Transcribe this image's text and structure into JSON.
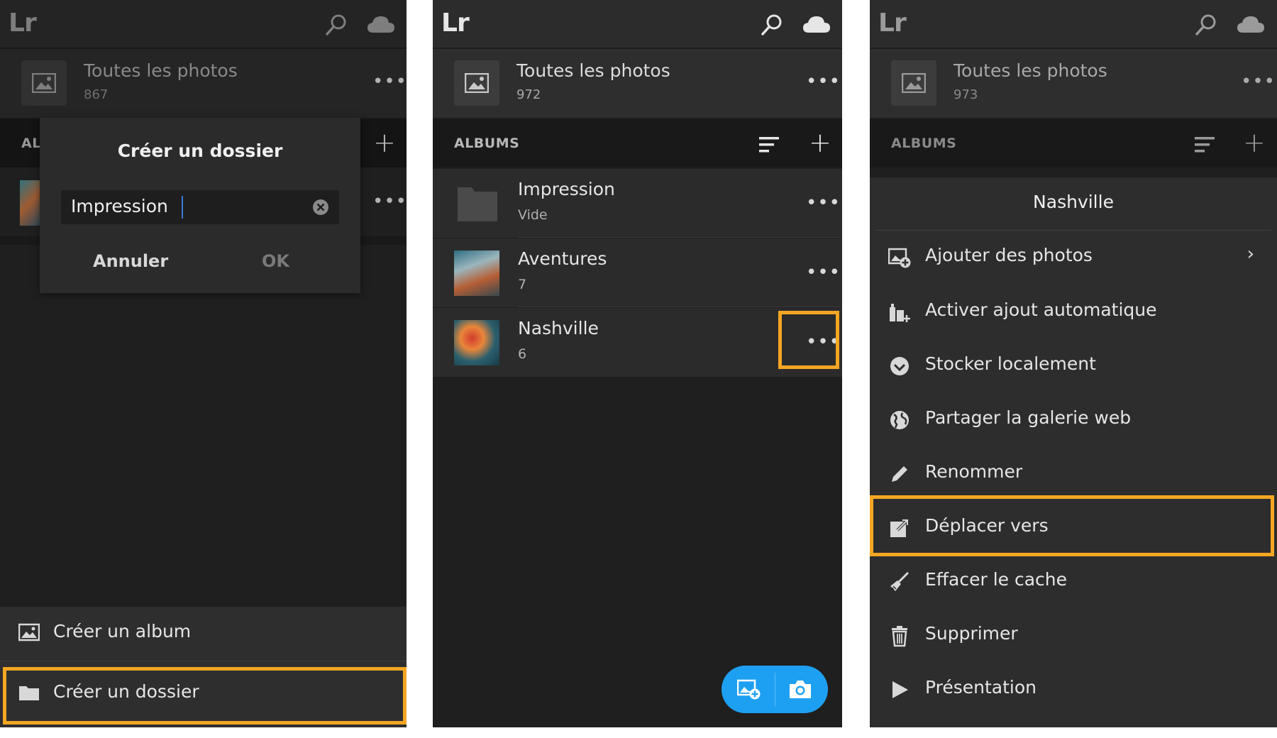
{
  "panel1": {
    "app_logo": "Lr",
    "all_photos": {
      "title": "Toutes les photos",
      "count": "867"
    },
    "albums_header": "ALI",
    "dialog": {
      "title": "Créer un dossier",
      "input_value": "Impression",
      "cancel_label": "Annuler",
      "ok_label": "OK"
    },
    "sheet": {
      "items": [
        {
          "label": "Créer un album",
          "icon": "album-icon"
        },
        {
          "label": "Créer un dossier",
          "icon": "folder-icon"
        }
      ]
    }
  },
  "panel2": {
    "app_logo": "Lr",
    "all_photos": {
      "title": "Toutes les photos",
      "count": "972"
    },
    "albums_header": "ALBUMS",
    "rows": [
      {
        "title": "Impression",
        "subtitle": "Vide",
        "thumb": "folder-icon"
      },
      {
        "title": "Aventures",
        "subtitle": "7",
        "thumb": "photo-thumbnail"
      },
      {
        "title": "Nashville",
        "subtitle": "6",
        "thumb": "photo-thumbnail"
      }
    ],
    "fab": {
      "left_icon": "add-photo-icon",
      "right_icon": "camera-icon",
      "color": "#1ea0f2"
    }
  },
  "panel3": {
    "app_logo": "Lr",
    "all_photos": {
      "title": "Toutes les photos",
      "count": "973"
    },
    "albums_header": "ALBUMS",
    "menu": {
      "title": "Nashville",
      "items": [
        {
          "label": "Ajouter des photos",
          "icon": "add-photos-icon",
          "has_chevron": true
        },
        {
          "label": "Activer ajout automatique",
          "icon": "auto-add-icon"
        },
        {
          "label": "Stocker localement",
          "icon": "download-check-icon"
        },
        {
          "label": "Partager la galerie web",
          "icon": "globe-icon"
        },
        {
          "label": "Renommer",
          "icon": "pencil-icon"
        },
        {
          "label": "Déplacer vers",
          "icon": "move-to-icon"
        },
        {
          "label": "Effacer le cache",
          "icon": "broom-icon"
        },
        {
          "label": "Supprimer",
          "icon": "trash-icon"
        },
        {
          "label": "Présentation",
          "icon": "play-icon"
        }
      ]
    }
  },
  "colors": {
    "highlight": "#f5a623",
    "background": "#1f1f1f",
    "topbar": "#2c2c2c"
  }
}
